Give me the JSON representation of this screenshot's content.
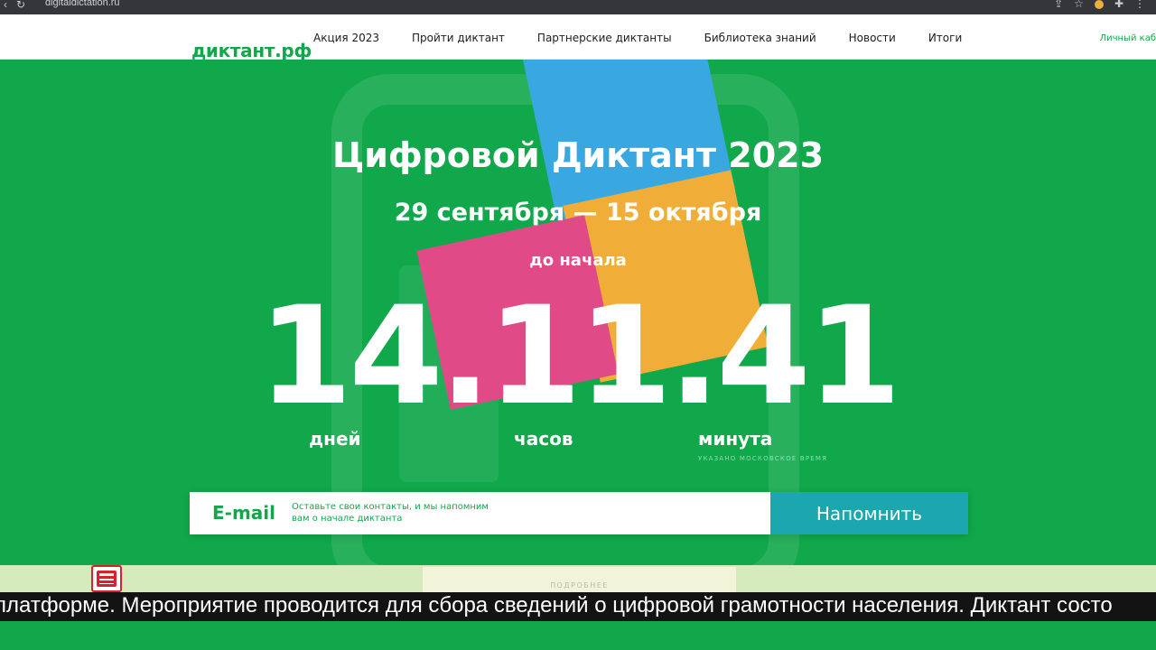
{
  "browser": {
    "url": "digitaldictation.ru",
    "nav_icons": [
      "back-icon",
      "reload-icon"
    ],
    "extension_icons": [
      "share-icon",
      "star-icon",
      "profile-icon",
      "extensions-icon",
      "menu-icon"
    ]
  },
  "header": {
    "logo": "диктант.рф",
    "menu": [
      "Акция 2023",
      "Пройти диктант",
      "Партнерские диктанты",
      "Библиотека знаний",
      "Новости",
      "Итоги"
    ],
    "cabinet": "Личный каб"
  },
  "hero": {
    "title": "Цифровой Диктант 2023",
    "dates": "29 сентября — 15 октября",
    "until_label": "до начала",
    "countdown": "14.11.41",
    "units": {
      "days": "дней",
      "hours": "часов",
      "minutes": "минута"
    },
    "timezone_note": "УКАЗАНО МОСКОВСКОЕ ВРЕМЯ",
    "colors": {
      "background": "#10a84a",
      "blue": "#3aa8e0",
      "yellow": "#f0ae38",
      "pink": "#e04a86"
    }
  },
  "form": {
    "field_label": "E-mail",
    "hint": "Оставьте свои контакты, и мы напомним вам о начале диктанта",
    "button": "Напомнить",
    "button_color": "#1ba7ad"
  },
  "more": {
    "label": "ПОДРОБНЕЕ"
  },
  "ticker": {
    "text": "платформе. Мероприятие проводится для сбора сведений о цифровой грамотности населения. Диктант состо"
  }
}
